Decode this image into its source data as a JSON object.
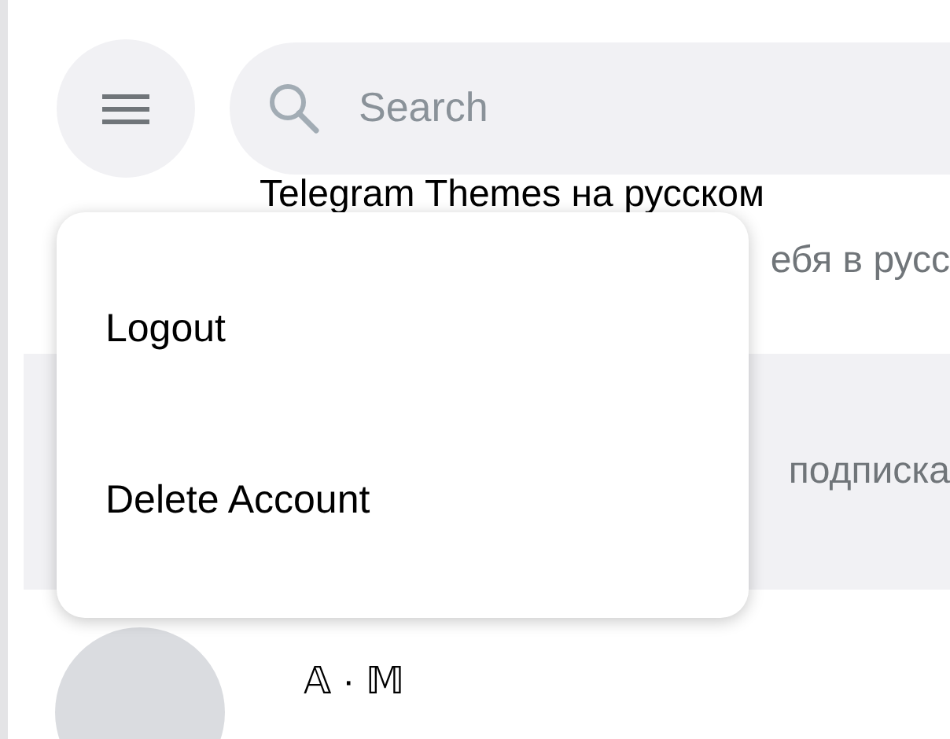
{
  "search": {
    "placeholder": "Search"
  },
  "chats": [
    {
      "kind": "under-menu",
      "title": "Telegram Themes на русском",
      "preview": "ебя в русс",
      "selected": false
    },
    {
      "kind": "under-menu",
      "preview": "подписка",
      "selected": true
    },
    {
      "kind": "full",
      "title": "𝔸 · 𝕄",
      "selected": false
    }
  ],
  "menu": {
    "items": [
      "Logout",
      "Delete Account"
    ]
  }
}
